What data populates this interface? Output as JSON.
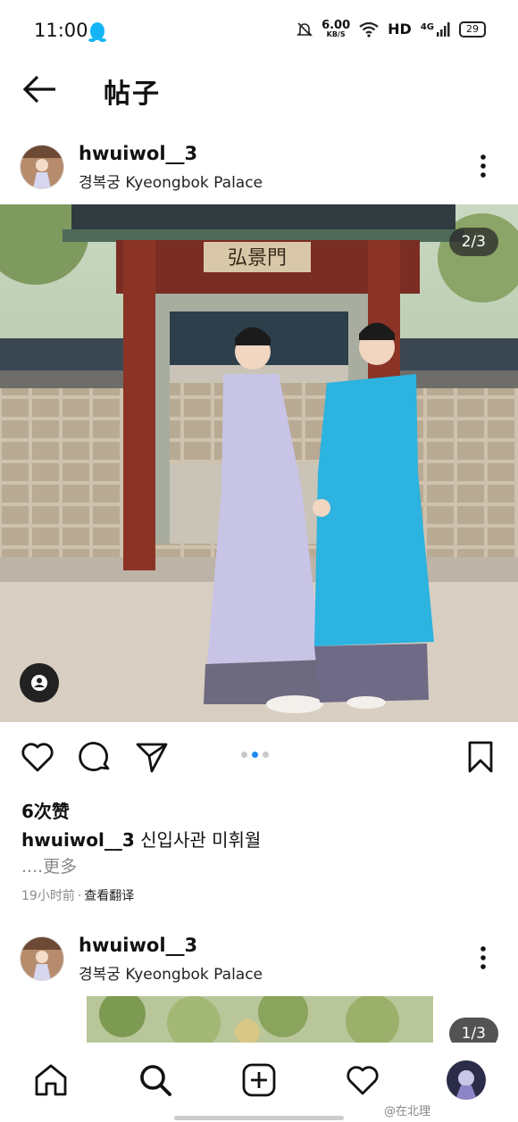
{
  "status_bar": {
    "time": "11:00",
    "net_speed_value": "6.00",
    "net_speed_unit": "KB/S",
    "network_label": "HD",
    "signal_label": "4G",
    "battery_level": "29",
    "icons": [
      "qq-penguin-icon",
      "bell-muted-icon",
      "wifi-icon",
      "signal-icon"
    ]
  },
  "app_bar": {
    "title": "帖子",
    "back_icon": "arrow-left-icon"
  },
  "post1": {
    "username": "hwuiwol__3",
    "location": "경복궁 Kyeongbok Palace",
    "photo_counter": "2/3",
    "carousel": {
      "total": 3,
      "active": 2
    },
    "gate_sign": "弘景門",
    "likes": "6次赞",
    "caption_username": "hwuiwol__3",
    "caption_text": "신입사관 미휘월",
    "more_text": "....更多",
    "time_ago": "19小时前",
    "separator": "·",
    "translate": "查看翻译"
  },
  "post2": {
    "username": "hwuiwol__3",
    "location": "경복궁 Kyeongbok Palace",
    "photo_counter": "1/3"
  },
  "bottom_nav": {
    "items": [
      "home-icon",
      "search-icon",
      "add-post-icon",
      "activity-heart-icon",
      "profile-avatar"
    ]
  },
  "watermark": "@在北理",
  "colors": {
    "accent_blue": "#1d8af0",
    "text": "#111111",
    "muted": "#8a8a8a"
  }
}
